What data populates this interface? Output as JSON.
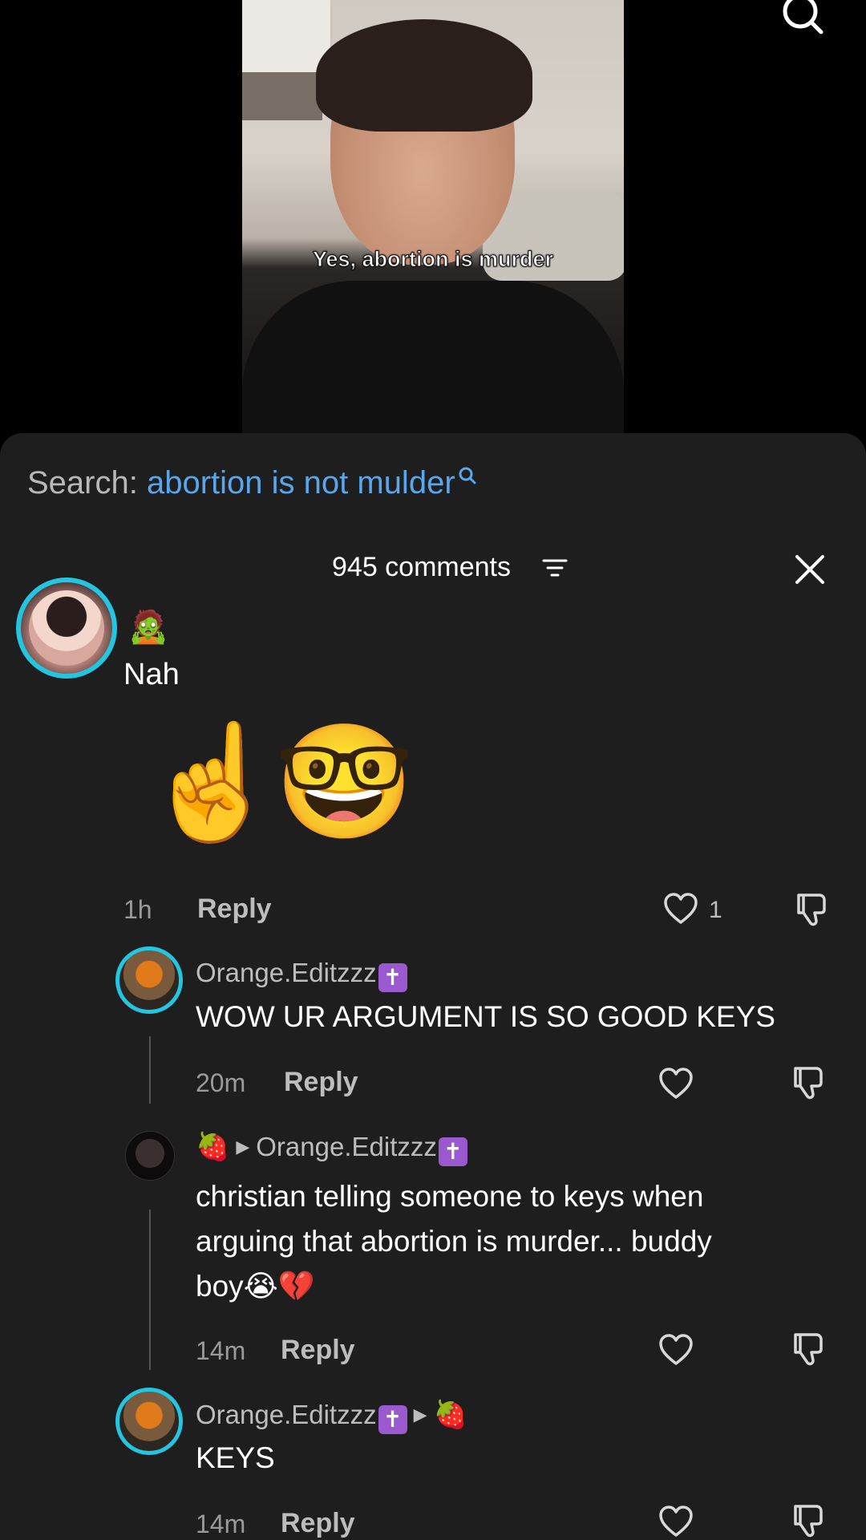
{
  "video": {
    "caption": "Yes, abortion is murder"
  },
  "header": {
    "search_icon": "search-icon"
  },
  "search": {
    "prefix": "Search:",
    "term": "abortion is not mulder"
  },
  "comments_header": {
    "count_label": "945 comments",
    "filter_icon": "filter-icon",
    "close_icon": "close-icon"
  },
  "comments": [
    {
      "username_emoji": "🧟",
      "text": "Nah",
      "emoji_line": "☝️🤓",
      "time": "1h",
      "reply_label": "Reply",
      "likes": "1"
    }
  ],
  "replies": [
    {
      "username": "Orange.Editzzz",
      "badge": "✝",
      "text": "WOW UR ARGUMENT IS SO GOOD KEYS",
      "time": "20m",
      "reply_label": "Reply"
    },
    {
      "username_emoji": "🍓",
      "reply_to": "Orange.Editzzz",
      "badge": "✝",
      "text_line1": "christian telling someone to keys when",
      "text_line2": "arguing that abortion is murder... buddy",
      "text_line3": "boy😭💔",
      "time": "14m",
      "reply_label": "Reply"
    },
    {
      "username": "Orange.Editzzz",
      "badge": "✝",
      "reply_to_emoji": "🍓",
      "text": "KEYS",
      "time": "14m",
      "reply_label": "Reply"
    }
  ],
  "colors": {
    "accent_link": "#5aa6ec",
    "avatar_ring": "#24c5e0",
    "sheet_bg": "#1e1e1e",
    "badge_purple": "#9b59d0"
  }
}
